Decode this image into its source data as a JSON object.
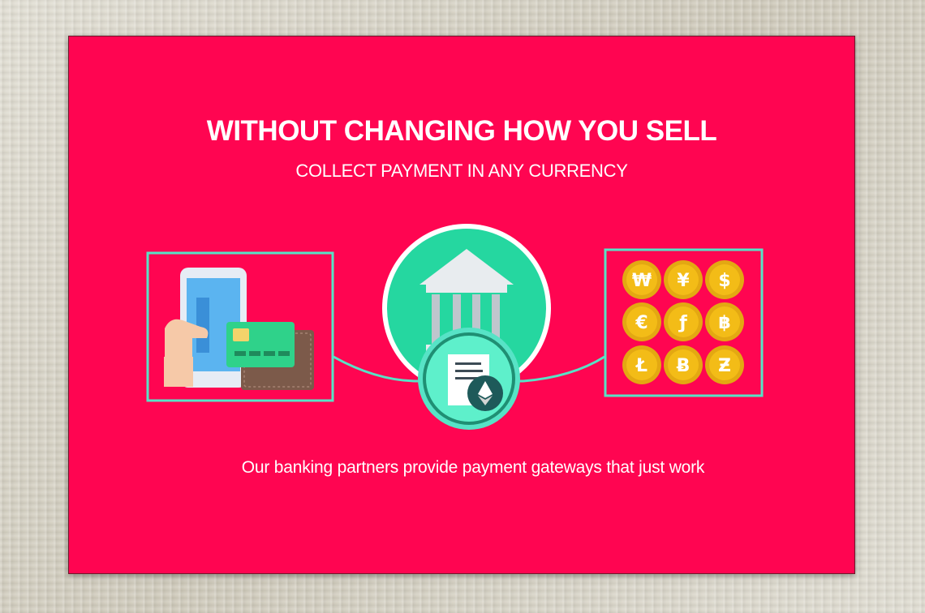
{
  "headline": "WITHOUT CHANGING HOW YOU SELL",
  "subheadline": "COLLECT PAYMENT IN ANY CURRENCY",
  "tagline": "Our banking partners provide payment gateways that just work",
  "colors": {
    "background": "#ff0551",
    "accent": "#57e3c6",
    "bank_circle": "#25d7a0",
    "coin": "#f3bc17"
  },
  "icons": {
    "left_panel": "phone-card-wallet-icon",
    "center": "bank-icon",
    "contract": "contract-ethereum-icon",
    "right_panel": "currency-coins-icon"
  },
  "coins": [
    "₩",
    "¥",
    "$",
    "€",
    "ƒ",
    "฿",
    "Ł",
    "Ƀ",
    "Ƶ"
  ]
}
